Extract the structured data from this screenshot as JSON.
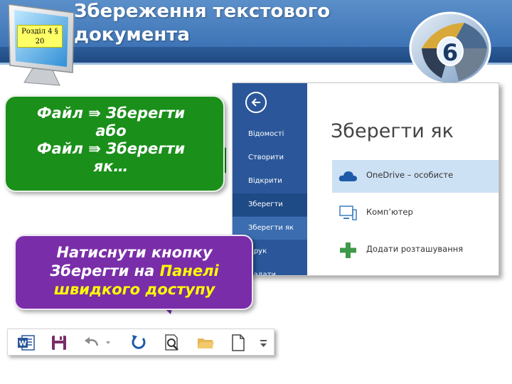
{
  "header": {
    "title": "Збереження текстового документа",
    "section_badge": "Розділ 4 § 20",
    "grade": "6"
  },
  "callouts": {
    "green": {
      "line1": "Файл ⇛ Зберегти",
      "line2": "або",
      "line3": "Файл ⇛ Зберегти",
      "line4": "як…"
    },
    "purple": {
      "part1": "Натиснути кнопку Зберегти на ",
      "highlight": "Панелі швидкого доступу"
    }
  },
  "save_as_window": {
    "menu": [
      {
        "label": "Відомості"
      },
      {
        "label": "Створити"
      },
      {
        "label": "Відкрити"
      },
      {
        "label": "Зберегти"
      },
      {
        "label": "Зберегти як"
      },
      {
        "label": "Друк"
      },
      {
        "label": "Надати"
      }
    ],
    "title": "Зберегти як",
    "locations": [
      {
        "label": "OneDrive – особисте",
        "icon": "cloud-icon"
      },
      {
        "label": "Комп’ютер",
        "icon": "computer-icon"
      },
      {
        "label": "Додати розташування",
        "icon": "plus-icon"
      }
    ],
    "colors": {
      "backstage": "#2b579a",
      "selected": "#cde1f5"
    }
  },
  "quick_access_toolbar": {
    "icons": [
      "word-icon",
      "save-icon",
      "undo-icon",
      "redo-icon",
      "print-preview-icon",
      "open-folder-icon",
      "new-document-icon",
      "customize-icon"
    ]
  }
}
